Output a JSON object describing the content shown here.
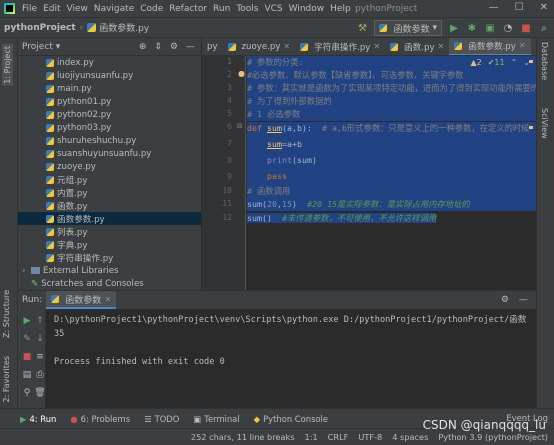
{
  "menubar": {
    "items": [
      "File",
      "Edit",
      "View",
      "Navigate",
      "Code",
      "Refactor",
      "Run",
      "Tools",
      "VCS",
      "Window",
      "Help"
    ],
    "window_title": "pythonProject"
  },
  "navbar": {
    "project": "pythonProject",
    "file": "函数参数.py",
    "run_config": "函数参数"
  },
  "project_panel": {
    "title": "Project",
    "files": [
      "index.py",
      "luojiyunsuanfu.py",
      "main.py",
      "python01.py",
      "python02.py",
      "python03.py",
      "shuruheshuchu.py",
      "suanshuyunsuanfu.py",
      "zuoye.py",
      "元组.py",
      "内置.py",
      "函数.py",
      "函数参数.py",
      "列表.py",
      "字典.py",
      "字符串操作.py"
    ],
    "selected": "函数参数.py",
    "external": "External Libraries",
    "scratches": "Scratches and Consoles"
  },
  "editor_tabs": {
    "labels": [
      "py",
      "zuoye.py",
      "字符串操作.py",
      "函数.py",
      "函数参数.py"
    ],
    "active": "函数参数.py"
  },
  "inspection": {
    "warnings": "▲2",
    "weak": "✔11"
  },
  "code": {
    "line_numbers": [
      "1",
      "2",
      "3",
      "4",
      "5",
      "6",
      "7",
      "8",
      "9",
      "10",
      "11",
      "12"
    ],
    "l1": "# 参数的分类:",
    "l2": "#必选参数、默认参数【缺省参数】、可选参数、关键字参数",
    "l3": "# 参数：其实就是函数为了实现某项特定功能，进而为了得到实现功能所需要的数据",
    "l4": "# 为了得到外部数据的",
    "l5": "# 1 必选参数",
    "l6_def": "def ",
    "l6_fn": "sum",
    "l6_rest": "(a,b):",
    "l6_cm": "  # a,b形式参数：只是意义上的一种参数，在定义的时候",
    "l7_a": "sum",
    "l7_b": "=a+b",
    "l8_a": "print",
    "l8_b": "(sum)",
    "l9": "pass",
    "l10": "# 函数调用",
    "l11_a": "sum(",
    "l11_b": "20",
    "l11_c": ",",
    "l11_d": "15",
    "l11_e": ")",
    "l11_cm": "  #20 15是实际参数：是实际占用内存地址的",
    "l12_a": "sum()",
    "l12_cm": "  #未传递参数，不可使用，不允许这样调用"
  },
  "run_panel": {
    "label": "Run:",
    "tab": "函数参数",
    "command": "D:\\pythonProject1\\pythonProject\\venv\\Scripts\\python.exe D:/pythonProject1/pythonProject/函数",
    "output": "35",
    "finished": "Process finished with exit code 0"
  },
  "left_strip": {
    "project": "1: Project",
    "structure": "Z: Structure",
    "favorites": "2: Favorites"
  },
  "right_strip": {
    "database": "Database",
    "sciview": "SciView"
  },
  "toolbar": {
    "run": "4: Run",
    "problems": "6: Problems",
    "todo": "TODO",
    "terminal": "Terminal",
    "console": "Python Console",
    "eventlog": "Event Log"
  },
  "status": {
    "chars": "252 chars, 11 line breaks",
    "pos": "1:1",
    "crlf": "CRLF",
    "enc": "UTF-8",
    "indent": "4 spaces",
    "interp": "Python 3.9 (pythonProject)"
  },
  "watermark": "CSDN @qianqqqq_lu",
  "colors": {
    "accent": "#4a88c7",
    "selection": "#214283",
    "comment": "#808080",
    "keyword": "#cc7832",
    "number": "#6897bb"
  }
}
